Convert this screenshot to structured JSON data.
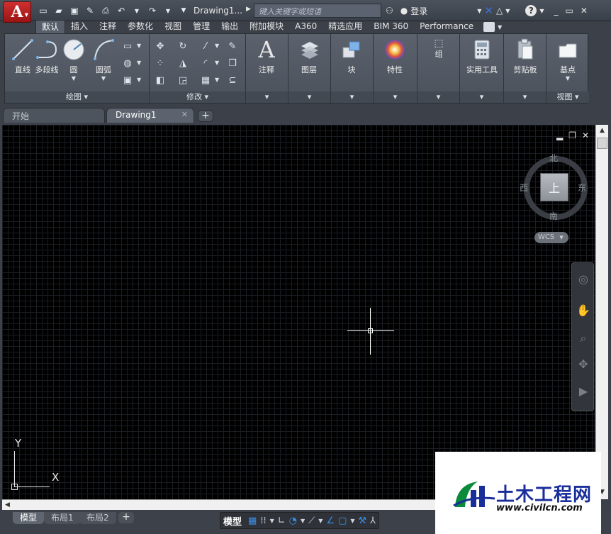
{
  "titlebar": {
    "app_logo": "A",
    "drawing_name": "Drawing1...",
    "search_placeholder": "键入关键字或短语",
    "login_label": "登录",
    "help_icon": "?"
  },
  "ribbon_tabs": [
    "默认",
    "插入",
    "注释",
    "参数化",
    "视图",
    "管理",
    "输出",
    "附加模块",
    "A360",
    "精选应用",
    "BIM 360",
    "Performance"
  ],
  "draw_panel": {
    "title": "绘图 ▾",
    "tools": [
      {
        "label": "直线",
        "icon": "line-icon"
      },
      {
        "label": "多段线",
        "icon": "polyline-icon"
      },
      {
        "label": "圆",
        "icon": "circle-icon"
      },
      {
        "label": "圆弧",
        "icon": "arc-icon"
      }
    ]
  },
  "modify_panel": {
    "title": "修改 ▾"
  },
  "big_panels": [
    {
      "label": "注释",
      "icon": "annotation-icon"
    },
    {
      "label": "图层",
      "icon": "layers-icon"
    },
    {
      "label": "块",
      "icon": "block-icon"
    },
    {
      "label": "特性",
      "icon": "properties-icon"
    },
    {
      "label": "组",
      "icon": "group-icon"
    },
    {
      "label": "实用工具",
      "icon": "calculator-icon"
    },
    {
      "label": "剪贴板",
      "icon": "clipboard-icon"
    },
    {
      "label": "基点",
      "icon": "basepoint-icon"
    }
  ],
  "view_panel_title": "视图 ▾",
  "doc_tabs": [
    {
      "label": "开始",
      "active": false
    },
    {
      "label": "Drawing1",
      "active": true
    }
  ],
  "viewcube": {
    "north": "北",
    "south": "南",
    "east": "东",
    "west": "西",
    "face": "上",
    "wcs": "WCS"
  },
  "ucs": {
    "x": "X",
    "y": "Y"
  },
  "layout_tabs": [
    {
      "label": "模型",
      "active": true
    },
    {
      "label": "布局1",
      "active": false
    },
    {
      "label": "布局2",
      "active": false
    }
  ],
  "status": {
    "model_label": "模型"
  },
  "watermark": {
    "name": "土木工程网",
    "url": "www.civilcn.com"
  }
}
